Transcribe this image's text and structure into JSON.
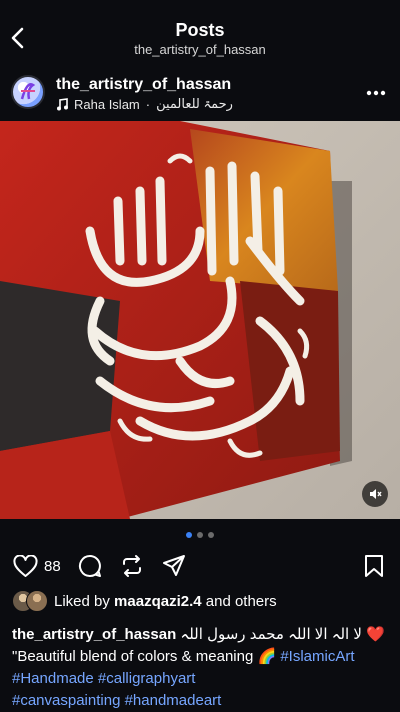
{
  "header": {
    "title": "Posts",
    "subtitle": "the_artistry_of_hassan"
  },
  "post": {
    "username": "the_artistry_of_hassan",
    "music_artist": "Raha Islam",
    "music_separator": "·",
    "music_track": "رحمۃ للعالمین",
    "like_count": "88",
    "carousel": {
      "count": 3,
      "active": 1
    },
    "liked_by_prefix": "Liked by",
    "liked_by_user": "maazqazi2.4",
    "liked_by_suffix": "and others",
    "caption_user": "the_artistry_of_hassan",
    "caption_arabic": "لا الہ الا اللہ محمد رسول اللہ",
    "caption_heart": "❤️",
    "caption_line2": "\"Beautiful blend of colors & meaning",
    "caption_rainbow": "🌈",
    "hashtags": [
      "#IslamicArt",
      "#Handmade",
      "#calligraphyart",
      "#canvaspainting",
      "#handmadeart"
    ]
  },
  "colors": {
    "background": "#0b0c10",
    "hashtag": "#76a6ff",
    "carousel_active": "#3b82f6",
    "heart": "#e0322b"
  },
  "icons": [
    "back-icon",
    "more-icon",
    "music-note-icon",
    "heart-icon",
    "comment-icon",
    "repost-icon",
    "share-icon",
    "bookmark-icon",
    "mute-icon"
  ]
}
